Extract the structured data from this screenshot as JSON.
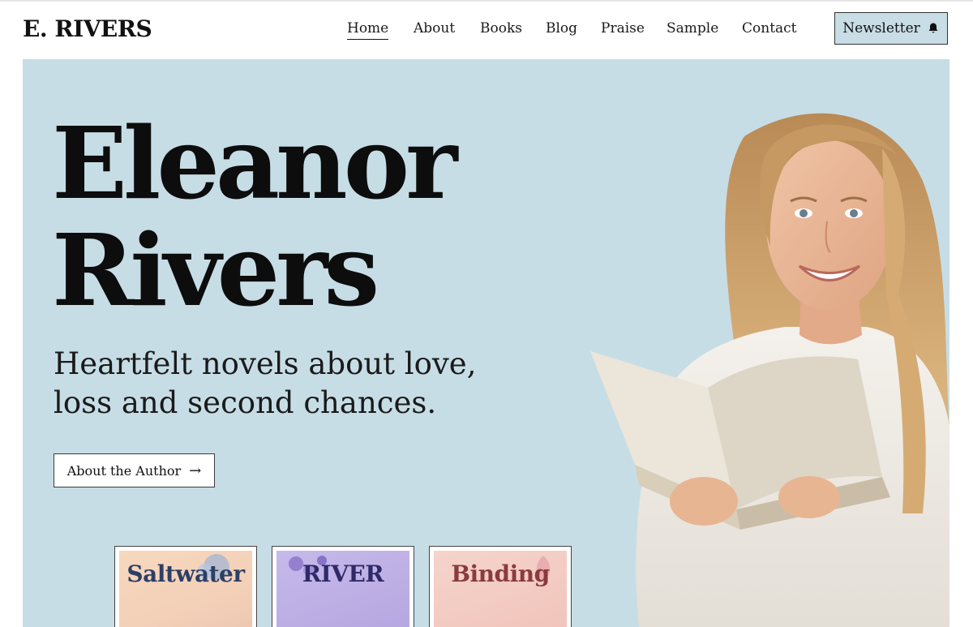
{
  "header": {
    "logo": "E. RIVERS",
    "nav": [
      {
        "label": "Home",
        "active": true
      },
      {
        "label": "About",
        "active": false
      },
      {
        "label": "Books",
        "active": false
      },
      {
        "label": "Blog",
        "active": false
      },
      {
        "label": "Praise",
        "active": false
      },
      {
        "label": "Sample",
        "active": false
      },
      {
        "label": "Contact",
        "active": false
      }
    ],
    "newsletter_label": "Newsletter",
    "newsletter_icon": "bell-icon"
  },
  "hero": {
    "headline_line1": "Eleanor",
    "headline_line2": "Rivers",
    "tagline": "Heartfelt novels about love, loss and second chances.",
    "cta_label": "About the Author",
    "cta_icon": "arrow-right-icon",
    "background_color": "#c7dde6"
  },
  "books": [
    {
      "title": "Saltwater"
    },
    {
      "title": "RIVER"
    },
    {
      "title": "Binding"
    }
  ]
}
